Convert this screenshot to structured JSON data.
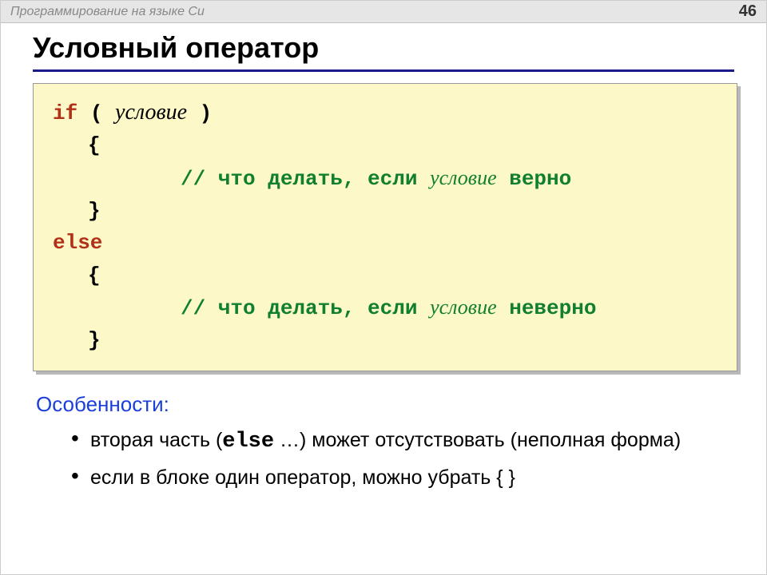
{
  "header": {
    "subject": "Программирование на языке Си",
    "page_number": "46"
  },
  "title": "Условный оператор",
  "code": {
    "kw_if": "if",
    "paren_open": "(",
    "condition": "условие",
    "paren_close": ")",
    "brace_open1": "{",
    "comment1_prefix": "// что делать, если ",
    "comment1_cond": "условие",
    "comment1_suffix": " верно",
    "brace_close1": "}",
    "kw_else": "else",
    "brace_open2": "{",
    "comment2_prefix": "// что делать, если ",
    "comment2_cond": "условие",
    "comment2_suffix": " неверно",
    "brace_close2": "}"
  },
  "features": {
    "heading": "Особенности:",
    "b1_a": "вторая часть (",
    "b1_kw": "else",
    "b1_b": " …) может отсутствовать (неполная форма)",
    "b2": "если в блоке один оператор, можно убрать { }"
  }
}
